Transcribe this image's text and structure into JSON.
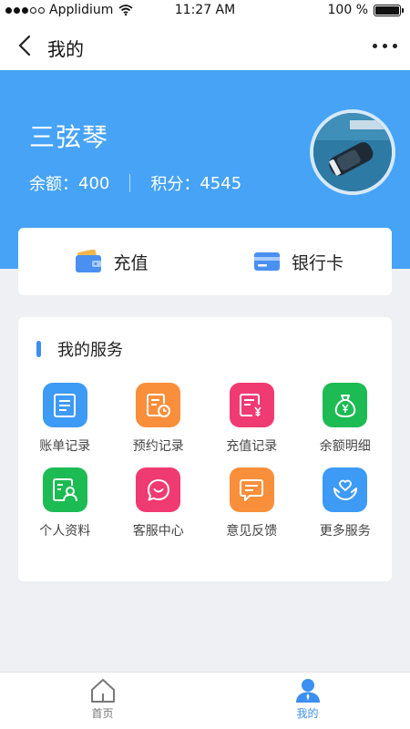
{
  "status_bar": {
    "carrier": "Applidium",
    "time": "11:27 AM",
    "battery": "100 %"
  },
  "nav": {
    "title": "我的"
  },
  "profile": {
    "name": "三弦琴",
    "balance_label": "余额：",
    "balance": "400",
    "points_label": "积分：",
    "points": "4545"
  },
  "actions": [
    {
      "label": "充值",
      "icon": "wallet-icon"
    },
    {
      "label": "银行卡",
      "icon": "bank-card-icon"
    }
  ],
  "services": {
    "title": "我的服务",
    "items": [
      {
        "label": "账单记录",
        "icon": "bill-icon",
        "color": "#3d9af5"
      },
      {
        "label": "预约记录",
        "icon": "appointment-icon",
        "color": "#f98f3a"
      },
      {
        "label": "充值记录",
        "icon": "recharge-record-icon",
        "color": "#f03a72"
      },
      {
        "label": "余额明细",
        "icon": "money-bag-icon",
        "color": "#1dbb53"
      },
      {
        "label": "个人资料",
        "icon": "profile-card-icon",
        "color": "#1dbb53"
      },
      {
        "label": "客服中心",
        "icon": "chat-smile-icon",
        "color": "#f03a72"
      },
      {
        "label": "意见反馈",
        "icon": "feedback-icon",
        "color": "#f98f3a"
      },
      {
        "label": "更多服务",
        "icon": "care-hands-icon",
        "color": "#3d9af5"
      }
    ]
  },
  "tabs": [
    {
      "label": "首页",
      "icon": "home-icon"
    },
    {
      "label": "我的",
      "icon": "user-icon"
    }
  ]
}
